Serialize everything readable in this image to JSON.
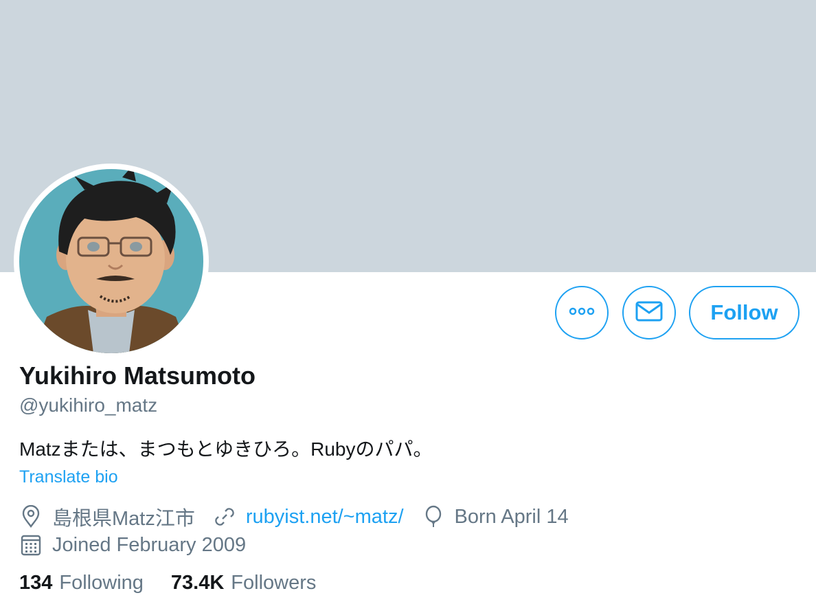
{
  "profile": {
    "name": "Yukihiro Matsumoto",
    "handle": "@yukihiro_matz",
    "bio": "Matzまたは、まつもとゆきひろ。Rubyのパパ。",
    "translate_label": "Translate bio",
    "location": "島根県Matz江市",
    "website": "rubyist.net/~matz/",
    "birthday": "Born April 14",
    "joined": "Joined February 2009"
  },
  "actions": {
    "more_icon": "more-dots-icon",
    "message_icon": "envelope-icon",
    "follow_label": "Follow"
  },
  "stats": {
    "following_count": "134",
    "following_label": "Following",
    "followers_count": "73.4K",
    "followers_label": "Followers"
  },
  "colors": {
    "accent": "#1da1f2",
    "banner": "#ccd6dd",
    "secondary_text": "#657786",
    "primary_text": "#14171a"
  }
}
